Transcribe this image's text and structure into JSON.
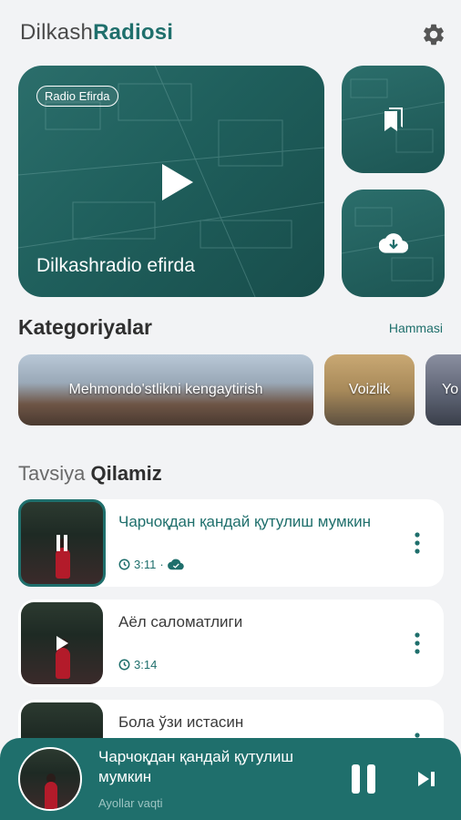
{
  "header": {
    "brand_light": "Dilkash",
    "brand_bold": "Radiosi",
    "settings_icon": "gear-icon"
  },
  "hero": {
    "badge": "Radio Efirda",
    "title": "Dilkashradio efirda",
    "play_icon": "play-icon"
  },
  "side_tiles": [
    {
      "icon": "bookmarks-icon"
    },
    {
      "icon": "cloud-download-icon"
    }
  ],
  "categories": {
    "title": "Kategoriyalar",
    "see_all": "Hammasi",
    "items": [
      {
        "label": "Mehmondo'stlikni kengaytirish"
      },
      {
        "label": "Voizlik"
      },
      {
        "label": "Yo"
      }
    ]
  },
  "recommend": {
    "title_light": "Tavsiya",
    "title_bold": "Qilamiz",
    "tracks": [
      {
        "title": "Чарчоқдан қандай қутулиш мумкин",
        "duration": "3:11",
        "state": "playing",
        "downloaded": true
      },
      {
        "title": "Аёл саломатлиги",
        "duration": "3:14",
        "state": "paused",
        "downloaded": false
      },
      {
        "title": "Бола ўзи истасин",
        "duration": "",
        "state": "paused",
        "downloaded": false
      }
    ]
  },
  "player": {
    "title": "Чарчоқдан қандай қутулиш мумкин",
    "subtitle": "Ayollar vaqti",
    "pause_icon": "pause-icon",
    "next_icon": "skip-next-icon"
  },
  "colors": {
    "accent": "#1f6f6c",
    "background": "#f2f3f5",
    "card": "#ffffff"
  }
}
